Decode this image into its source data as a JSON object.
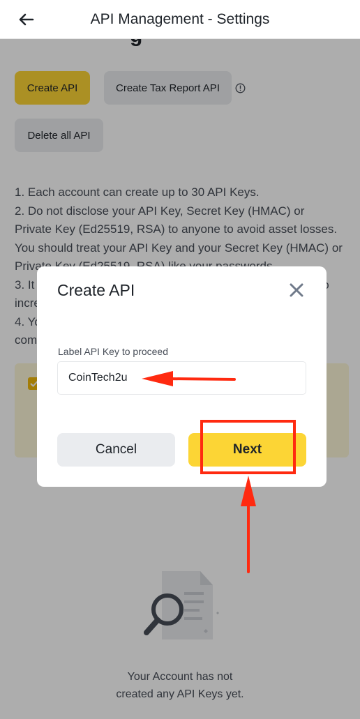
{
  "header": {
    "title": "API Management - Settings",
    "back_icon": "arrow-left-icon"
  },
  "page": {
    "partial_heading": "g",
    "create_api_label": "Create API",
    "create_tax_label": "Create Tax Report API",
    "info_icon": "info-circle-icon",
    "delete_all_label": "Delete all API",
    "instructions": "1. Each account can create up to 30 API Keys.\n2. Do not disclose your API Key, Secret Key (HMAC) or Private Key (Ed25519, RSA) to anyone to avoid asset losses. You should treat your API Key and your Secret Key (HMAC) or Private Key (Ed25519, RSA) like your passwords.\n3. It is recommended to restrict access to trusted IPs only to increase your account security.\n4. You will not be able to create an API Key if KYC is not completed.",
    "empty_text": "Your Account has not\ncreated any API Keys yet."
  },
  "modal": {
    "title": "Create API",
    "close_icon": "close-icon",
    "field_label": "Label API Key to proceed",
    "field_value": "CoinTech2u",
    "cancel_label": "Cancel",
    "next_label": "Next"
  },
  "colors": {
    "accent_yellow": "#fcd535",
    "annotation_red": "#ff2a10"
  }
}
